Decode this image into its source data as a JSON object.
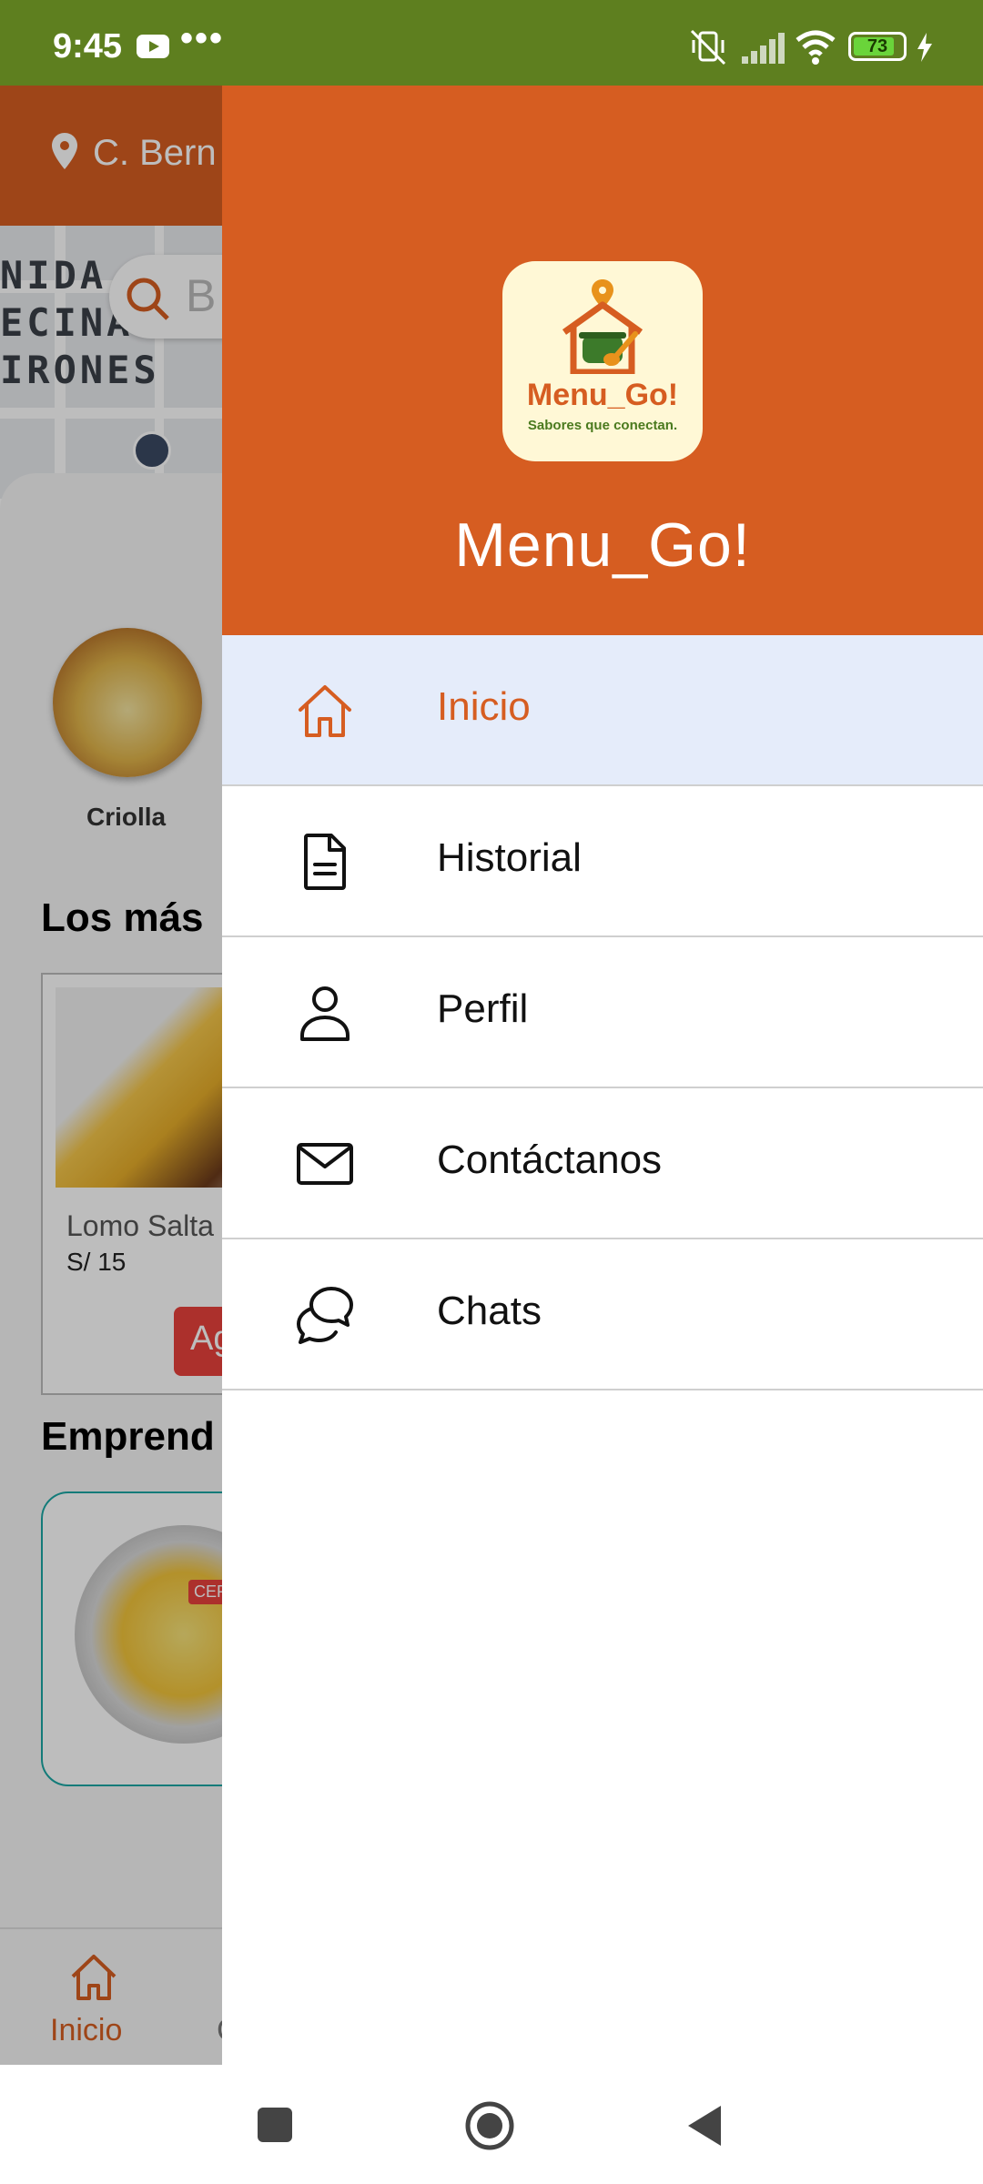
{
  "status_bar": {
    "time": "9:45",
    "more": "•••",
    "battery": "73"
  },
  "background_app": {
    "address": "C. Bern",
    "search_placeholder": "B",
    "map_labels": [
      "NIDA",
      "ECINA",
      "IRONES"
    ],
    "category": "Criolla",
    "section_popular": "Los más",
    "card_name": "Lomo Salta",
    "card_price": "S/ 15",
    "card_button": "Ag",
    "section_emprend": "Emprend",
    "badge": "CERR",
    "bottom_nav_label": "Inicio",
    "bottom_nav_next": "C"
  },
  "drawer": {
    "logo_word": "Menu_Go!",
    "logo_tagline": "Sabores que conectan.",
    "title": "Menu_Go!",
    "items": [
      {
        "label": "Inicio",
        "icon": "home-icon",
        "active": true
      },
      {
        "label": "Historial",
        "icon": "document-icon",
        "active": false
      },
      {
        "label": "Perfil",
        "icon": "person-icon",
        "active": false
      },
      {
        "label": "Contáctanos",
        "icon": "mail-icon",
        "active": false
      },
      {
        "label": "Chats",
        "icon": "chat-icon",
        "active": false
      }
    ]
  },
  "colors": {
    "brand": "#d65d21",
    "status_bar": "#5e7f1f",
    "active_item_bg": "#e5ecfa"
  }
}
